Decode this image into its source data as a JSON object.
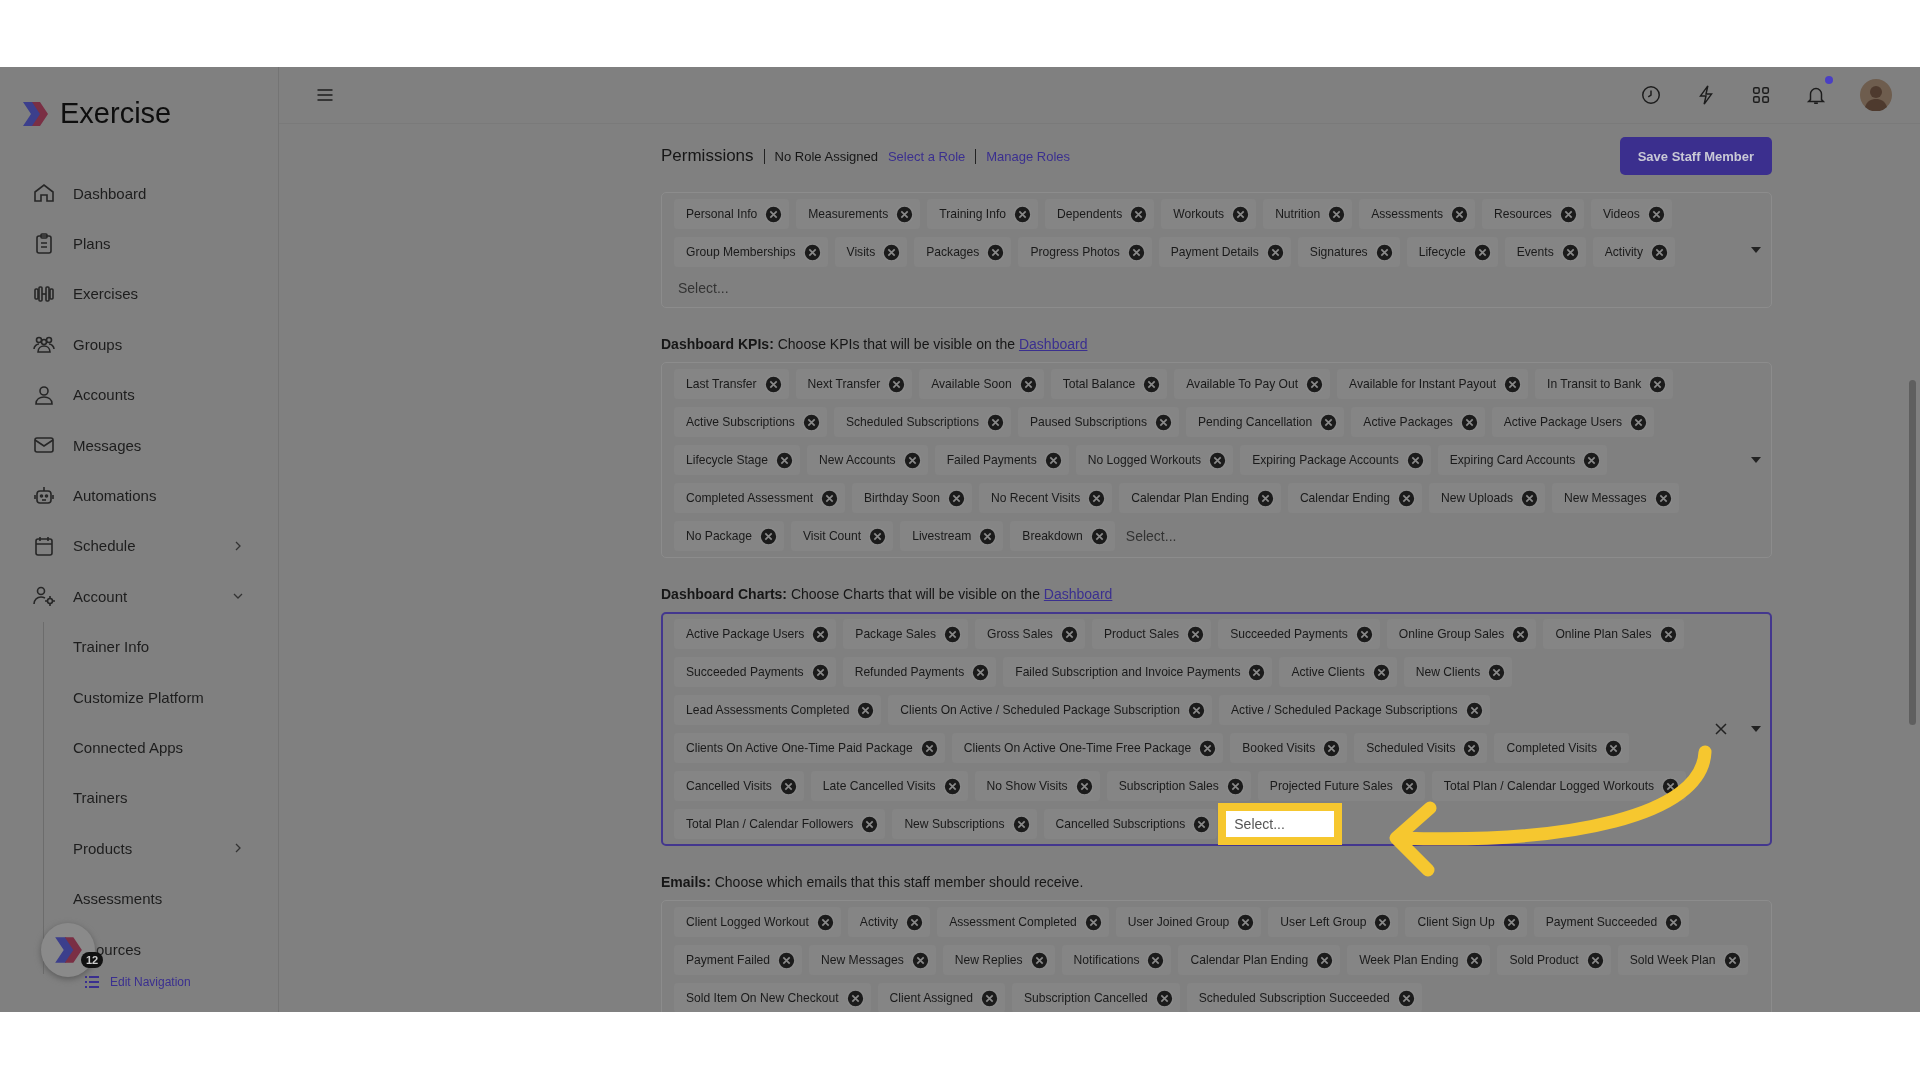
{
  "brand": "Exercise",
  "sidebar": {
    "items": [
      {
        "label": "Dashboard"
      },
      {
        "label": "Plans"
      },
      {
        "label": "Exercises"
      },
      {
        "label": "Groups"
      },
      {
        "label": "Accounts"
      },
      {
        "label": "Messages"
      },
      {
        "label": "Automations"
      },
      {
        "label": "Schedule",
        "expanded": false
      },
      {
        "label": "Account",
        "expanded": true,
        "children": [
          {
            "label": "Trainer Info"
          },
          {
            "label": "Customize Platform"
          },
          {
            "label": "Connected Apps"
          },
          {
            "label": "Trainers"
          },
          {
            "label": "Products",
            "expanded": false
          },
          {
            "label": "Assessments"
          },
          {
            "label": "ources"
          }
        ]
      }
    ],
    "edit_link": "Edit Navigation",
    "launcher_badge": "12"
  },
  "header": {
    "notifications_unread": true
  },
  "permissions": {
    "title": "Permissions",
    "role": "No Role Assigned",
    "links": [
      "Select a Role",
      "Manage Roles"
    ],
    "save_button": "Save Staff Member"
  },
  "sections": [
    {
      "focused": false,
      "tags": [
        "Personal Info",
        "Measurements",
        "Training Info",
        "Dependents",
        "Workouts",
        "Nutrition",
        "Assessments",
        "Resources",
        "Videos",
        "Group Memberships",
        "Visits",
        "Packages",
        "Progress Photos",
        "Payment Details",
        "Signatures",
        "Lifecycle",
        "Events",
        "Activity"
      ],
      "placeholder": "Select..."
    },
    {
      "label": "Dashboard KPIs:",
      "text": "Choose KPIs that will be visible on the",
      "link": "Dashboard",
      "focused": false,
      "tags": [
        "Last Transfer",
        "Next Transfer",
        "Available Soon",
        "Total Balance",
        "Available To Pay Out",
        "Available for Instant Payout",
        "In Transit to Bank",
        "Active Subscriptions",
        "Scheduled Subscriptions",
        "Paused Subscriptions",
        "Pending Cancellation",
        "Active Packages",
        "Active Package Users",
        "Lifecycle Stage",
        "New Accounts",
        "Failed Payments",
        "No Logged Workouts",
        "Expiring Package Accounts",
        "Expiring Card Accounts",
        "Completed Assessment",
        "Birthday Soon",
        "No Recent Visits",
        "Calendar Plan Ending",
        "Calendar Ending",
        "New Uploads",
        "New Messages",
        "No Package",
        "Visit Count",
        "Livestream",
        "Breakdown"
      ],
      "placeholder": "Select..."
    },
    {
      "label": "Dashboard Charts:",
      "text": "Choose Charts that will be visible on the",
      "link": "Dashboard",
      "focused": true,
      "highlighted": true,
      "tags": [
        "Active Package Users",
        "Package Sales",
        "Gross Sales",
        "Product Sales",
        "Succeeded Payments",
        "Online Group Sales",
        "Online Plan Sales",
        "Succeeded Payments",
        "Refunded Payments",
        "Failed Subscription and Invoice Payments",
        "Active Clients",
        "New Clients",
        "Lead Assessments Completed",
        "Clients On Active / Scheduled Package Subscription",
        "Active / Scheduled Package Subscriptions",
        "Clients On Active One-Time Paid Package",
        "Clients On Active One-Time Free Package",
        "Booked Visits",
        "Scheduled Visits",
        "Completed Visits",
        "Cancelled Visits",
        "Late Cancelled Visits",
        "No Show Visits",
        "Subscription Sales",
        "Projected Future Sales",
        "Total Plan / Calendar Logged Workouts",
        "Total Plan / Calendar Followers",
        "New Subscriptions",
        "Cancelled Subscriptions"
      ],
      "placeholder": "Select..."
    },
    {
      "label": "Emails:",
      "text": "Choose which emails that this staff member should receive.",
      "focused": false,
      "tags": [
        "Client Logged Workout",
        "Activity",
        "Assessment Completed",
        "User Joined Group",
        "User Left Group",
        "Client Sign Up",
        "Payment Succeeded",
        "Payment Failed",
        "New Messages",
        "New Replies",
        "Notifications",
        "Calendar Plan Ending",
        "Week Plan Ending",
        "Sold Product",
        "Sold Week Plan",
        "Sold Item On New Checkout",
        "Client Assigned",
        "Subscription Cancelled",
        "Scheduled Subscription Succeeded"
      ]
    }
  ]
}
